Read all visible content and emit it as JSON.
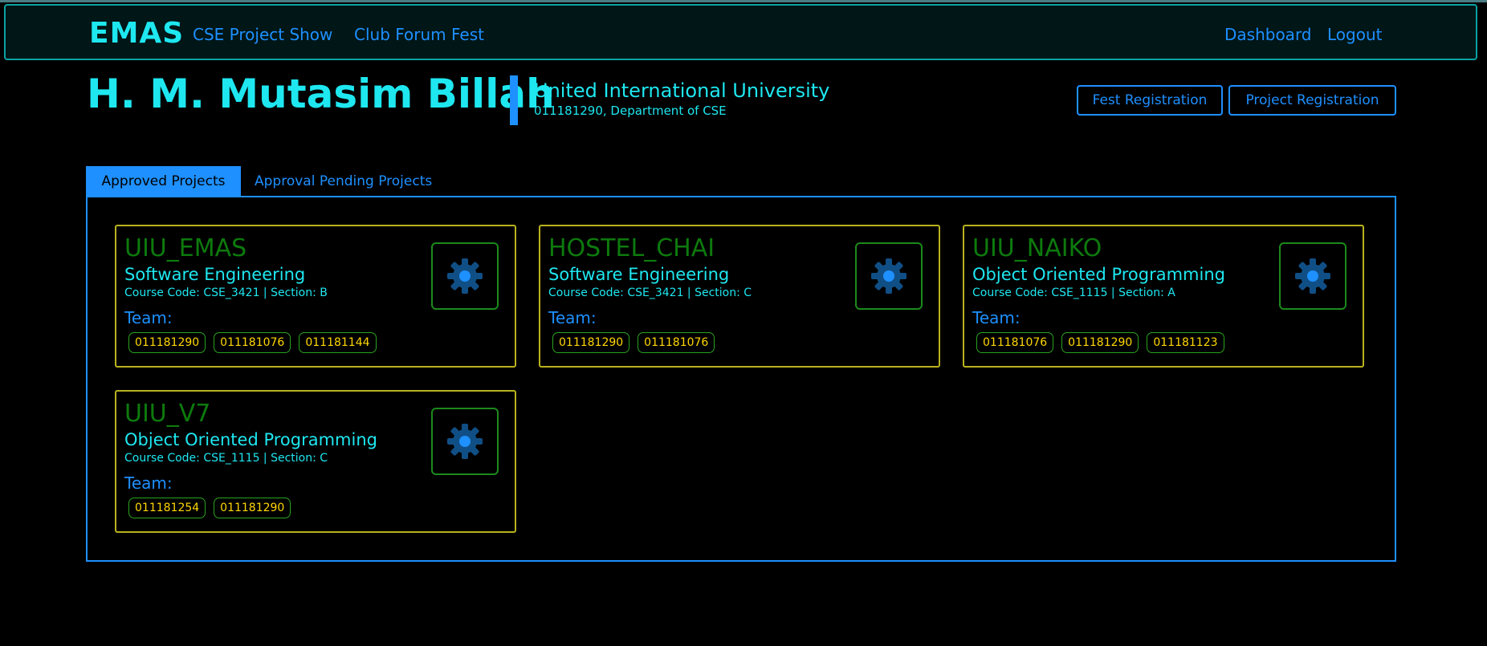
{
  "navbar": {
    "brand": "EMAS",
    "links_left": [
      "CSE Project Show",
      "Club Forum Fest"
    ],
    "links_right": [
      "Dashboard",
      "Logout"
    ]
  },
  "profile": {
    "name": "H. M. Mutasim Billah",
    "university": "United International University",
    "details": "011181290, Department of CSE"
  },
  "actions": {
    "fest_registration": "Fest Registration",
    "project_registration": "Project Registration"
  },
  "tabs": {
    "approved": "Approved Projects",
    "pending": "Approval Pending Projects"
  },
  "team_label": "Team:",
  "projects": [
    {
      "title": "UIU_EMAS",
      "course": "Software Engineering",
      "meta": "Course Code: CSE_3421 | Section: B",
      "team": [
        "011181290",
        "011181076",
        "011181144"
      ],
      "icon": "gear-icon"
    },
    {
      "title": "HOSTEL_CHAI",
      "course": "Software Engineering",
      "meta": "Course Code: CSE_3421 | Section: C",
      "team": [
        "011181290",
        "011181076"
      ],
      "icon": "gear-icon"
    },
    {
      "title": "UIU_NAIKO",
      "course": "Object Oriented Programming",
      "meta": "Course Code: CSE_1115 | Section: A",
      "team": [
        "011181076",
        "011181290",
        "011181123"
      ],
      "icon": "gear-icon"
    },
    {
      "title": "UIU_V7",
      "course": "Object Oriented Programming",
      "meta": "Course Code: CSE_1115 | Section: C",
      "team": [
        "011181254",
        "011181290"
      ],
      "icon": "gear-icon"
    }
  ],
  "colors": {
    "background": "#000000",
    "accent": "#1e90ff",
    "cyan": "#1ee7f0",
    "card_border": "#b9b21d",
    "title_green": "#0d7a0d",
    "chip_text": "#ffd700"
  }
}
